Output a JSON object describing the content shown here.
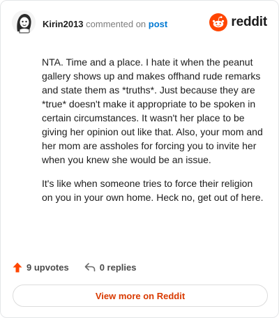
{
  "comment": {
    "username": "Kirin2013",
    "commented_on_text": "commented on",
    "post_link_text": "post",
    "paragraphs": [
      "NTA. Time and a place. I hate it when the peanut gallery shows up and makes offhand rude remarks and state them as *truths*. Just because they are *true* doesn't make it appropriate to be spoken in certain circumstances. It wasn't her place to be giving her opinion out like that. Also, your mom and her mom are assholes for forcing you to invite her when you knew she would be an issue.",
      "It's like when someone tries to force their religion on you in your own home. Heck no, get out of here."
    ]
  },
  "brand": {
    "name": "reddit",
    "color": "#ff4500"
  },
  "actions": {
    "upvotes_label": "9 upvotes",
    "replies_label": "0 replies"
  },
  "view_button_label": "View more on Reddit",
  "colors": {
    "accent_text": "#d93a00",
    "link": "#0079d3"
  },
  "icons": [
    "avatar-icon",
    "reddit-logo-icon",
    "upvote-arrow-icon",
    "reply-arrow-icon"
  ]
}
